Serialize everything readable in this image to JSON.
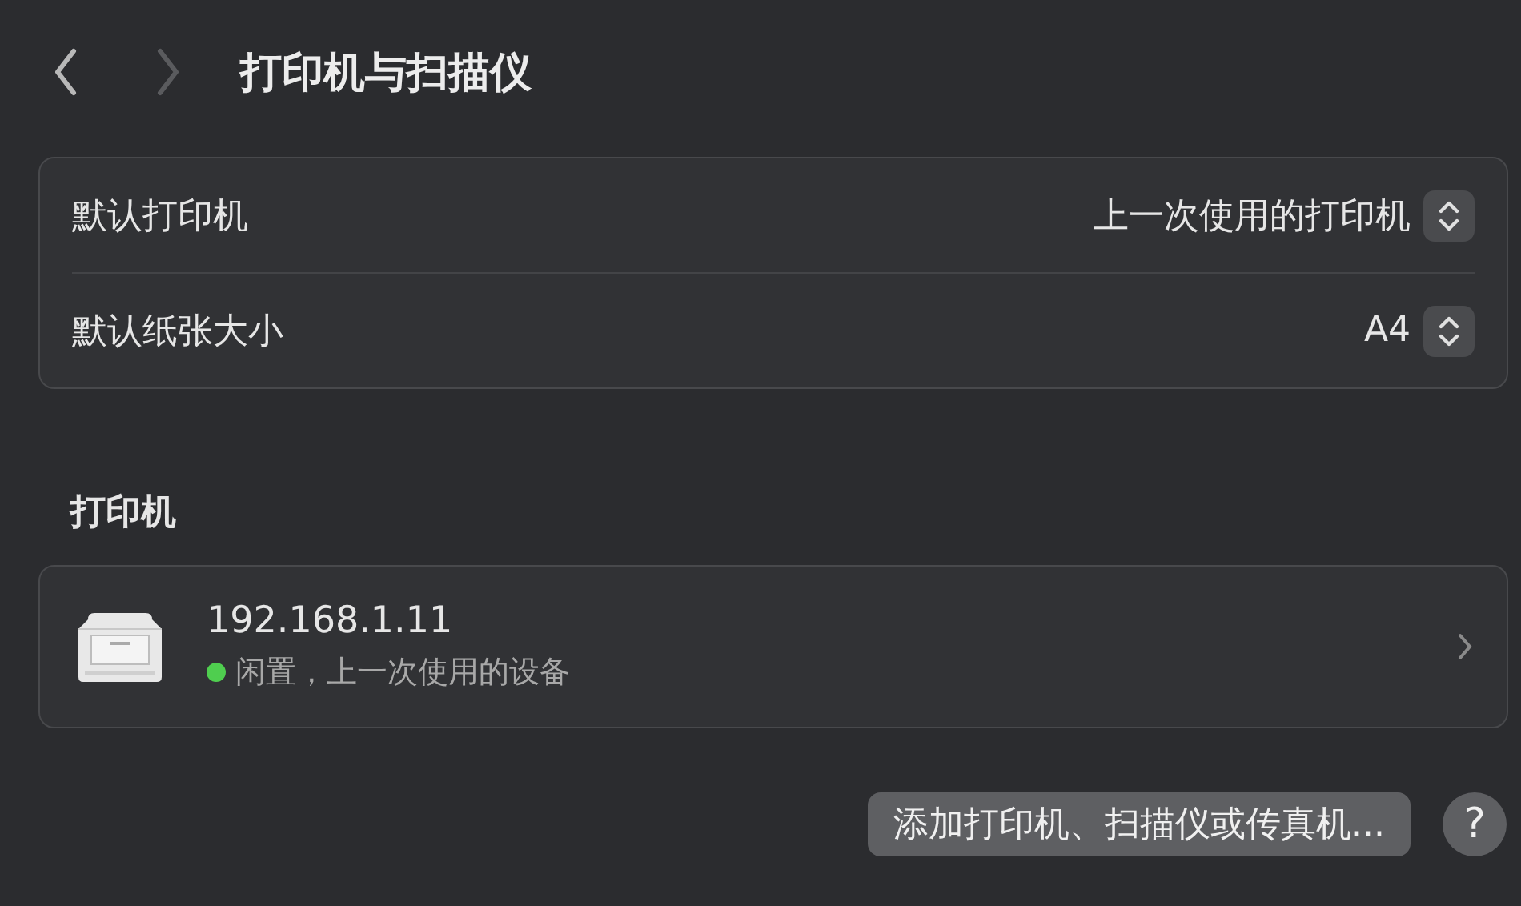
{
  "toolbar": {
    "back": {
      "disabled": false
    },
    "forward": {
      "disabled": true
    },
    "title": "打印机与扫描仪"
  },
  "settings": [
    {
      "label": "默认打印机",
      "value": "上一次使用的打印机"
    },
    {
      "label": "默认纸张大小",
      "value": "A4"
    }
  ],
  "printers_section": {
    "heading": "打印机",
    "printers": [
      {
        "name": "192.168.1.11",
        "status": "闲置，上一次使用的设备",
        "color": "#4fce4f"
      }
    ]
  },
  "buttons": {
    "add": "添加打印机、扫描仪或传真机...",
    "help": "?"
  }
}
